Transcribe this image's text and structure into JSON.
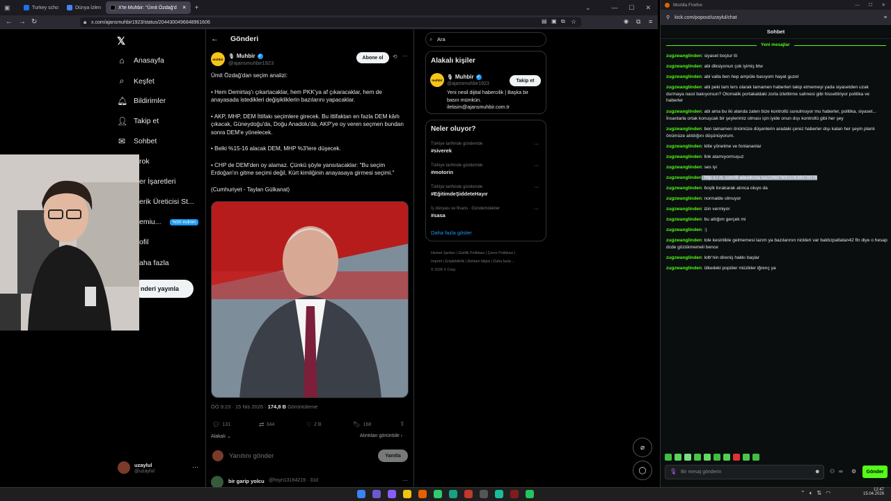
{
  "browser": {
    "tabs": [
      {
        "label": "Turkey scho"
      },
      {
        "label": "Dünya İzlen"
      },
      {
        "label": "X'te  Muhbir: \"Ümit Özdağ'd"
      }
    ],
    "url": "x.com/ajansmuhbir1923/status/2044300496848961606"
  },
  "xnav": {
    "items": [
      {
        "label": "Anasayfa",
        "icon": "home-icon"
      },
      {
        "label": "Keşfet",
        "icon": "search-icon"
      },
      {
        "label": "Bildirimler",
        "icon": "bell-icon"
      },
      {
        "label": "Takip et",
        "icon": "add-user-icon"
      },
      {
        "label": "Sohbet",
        "icon": "chat-icon"
      },
      {
        "label": "rok",
        "icon": "grok-icon"
      },
      {
        "label": "er İşaretleri",
        "icon": "bookmark-icon"
      },
      {
        "label": "erik Üreticisi St...",
        "icon": "creator-icon"
      },
      {
        "label": "emiu...",
        "icon": "premium-icon"
      },
      {
        "label": "ofil",
        "icon": "profile-icon"
      },
      {
        "label": "aha fazla",
        "icon": "more-icon"
      }
    ],
    "premium_badge": "%50 indirim",
    "post_button": "nderi yayınla",
    "user_name": "uzaylul",
    "user_handle": "@uzaylul"
  },
  "post": {
    "header": "Gönderi",
    "author": "Muhbir",
    "handle": "@ajansmuhbir1923",
    "subscribe": "Abone ol",
    "avatar_text": "muhbir",
    "text_lines": [
      "Ümit Özdağ'dan seçim analizi:",
      "• Hem Demirtaş'ı çıkartacaklar, hem PKK'ya af çıkaracaklar, hem de anayasada istedikleri değişikliklerin bazılarını yapacaklar.",
      "• AKP, MHP, DEM İttifakı seçimlere girecek. Bu ittifaktan en fazla DEM kârlı çıkacak, Güneydoğu'da, Doğu Anadolu'da, AKP'ye oy veren seçmen bundan sonra DEM'e yönelecek.",
      "• Belki %15-16 alacak DEM, MHP %3'lere düşecek.",
      "• CHP de DEM'den oy alamaz. Çünkü şöyle yansıtacaklar: \"Bu seçim Erdoğan'ın gitme seçimi değil, Kürt kimliğinin anayasaya girmesi seçimi.\"",
      "(Cumhuriyet - Taylan Gülkanat)"
    ],
    "meta_time": "ÖÖ 9:23 · 15 Nis 2026 · ",
    "meta_views": "174,8 B",
    "meta_views_label": " Görüntüleme",
    "stats": {
      "replies": "131",
      "reposts": "344",
      "likes": "2 B",
      "bookmarks": "168"
    },
    "relevant": "Alakalı ⌄",
    "view_quotes": "Alıntıları görüntüle ›",
    "reply_placeholder": "Yanıtını gönder",
    "reply_button": "Yanıtla",
    "next_reply_name": "bir garip yolcu",
    "next_reply_meta": "@hsyn13164219 · 31d"
  },
  "right": {
    "search_placeholder": "Ara",
    "related_title": "Alakalı kişiler",
    "related_name": "Muhbir",
    "related_handle": "@ajansmuhbir1923",
    "follow": "Takip et",
    "related_bio": "Yeni nesil dijital habercilik | Başka bir basın mümkün. iletisim@ajansmuhbir.com.tr",
    "trends_title": "Neler oluyor?",
    "trends": [
      {
        "context": "Türkiye tarihinde gündemde",
        "tag": "#siverek"
      },
      {
        "context": "Türkiye tarihinde gündemde",
        "tag": "#motorin"
      },
      {
        "context": "Türkiye tarihinde gündemde",
        "tag": "#EğitimdeŞiddeteHayır"
      },
      {
        "context": "İş dünyası ve finans · Gündemdekiler",
        "tag": "#sasa"
      }
    ],
    "show_more": "Daha fazla göster",
    "footer": [
      "Hizmet Şartları",
      "Gizlilik Politikası",
      "Çerez Politikası",
      "Imprint",
      "Erişilebilirlik",
      "Reklam bilgisi",
      "Daha fazla ...",
      "© 2026 X Corp."
    ]
  },
  "chat": {
    "window_title": "Mozilla Firefox",
    "url": "kick.com/popout/uzaylul/chat",
    "title": "Sohbet",
    "new_messages": "Yeni mesajlar",
    "messages": [
      {
        "user": "zugzwanglinden",
        "text": ": siyaset boştur lö"
      },
      {
        "user": "zugzwanglinden",
        "text": ": abi diksiyonun çok iyimiş btw"
      },
      {
        "user": "zugzwanglinden",
        "text": ": abi valla ben hep ampüle basıyom hayat guzel"
      },
      {
        "user": "zugzwanglinden",
        "text": ": abi peki tam ters olarak tamamen haberleri takip etmemeyi yada siyasetden uzak durmaya nasıl bakıyorsun? Otomatik portakaldaki zorla izlettirme sahnesi gibi hissettiriyor politika ve haberler"
      },
      {
        "user": "zugzwanglinden",
        "text": ": abi ama bu iki alanda zaten bize kontrollü sunulmuyor mu haberler, politika, siyaset... İnsanlarla ortak konuşcak bir şeylerimiz olması için iyide onun dışı kontrollü gibi her şey"
      },
      {
        "user": "zugzwanglinden",
        "text": ": ben tamamen önümüze düşenlerin aradaki çerez haberler dışı kalan her şeyin planlı önümüze atıldığını düşünüyorum."
      },
      {
        "user": "zugzwanglinden",
        "text": ": kitle yönetme ve fonlananlar"
      },
      {
        "user": "zugzwanglinden",
        "text": ": link atamıyormuşuz"
      },
      {
        "user": "zugzwanglinden",
        "text": ": ses iyi"
      },
      {
        "user": "zugzwanglinden",
        "text": ": http s:/ /x. com/B aileolk/sta tus/1968769010638978078"
      },
      {
        "user": "zugzwanglinden",
        "text": ": boşlk bırakarak atınca oluyo da"
      },
      {
        "user": "zugzwanglinden",
        "text": ": normalde olmuyor"
      },
      {
        "user": "zugzwanglinden",
        "text": ": izin vermiyor"
      },
      {
        "user": "zugzwanglinden",
        "text": ": bu attığım gerçek mi"
      },
      {
        "user": "zugzwanglinden",
        "text": ": :)"
      },
      {
        "user": "zugzwanglinden",
        "text": ": lole kesinlikle gelmemesi lazım ya bazılarının nickleri var baldızpatlatan42 fln diye o hesap dcde gözükmemeli bence"
      },
      {
        "user": "zugzwanglinden",
        "text": ": loltr'nin direniş hakkı başlar"
      },
      {
        "user": "zugzwanglinden",
        "text": ": ülkedeki popüler müzikler iğrenç ya"
      }
    ],
    "input_placeholder": "Bir mesaj gönderin",
    "send": "Gönder"
  },
  "taskbar": {
    "time": "12:47",
    "date": "15.04.2026"
  },
  "colors": {
    "kick_green": "#53fc18",
    "x_blue": "#1d9bf0",
    "muhbir_yellow": "#f5c518"
  }
}
